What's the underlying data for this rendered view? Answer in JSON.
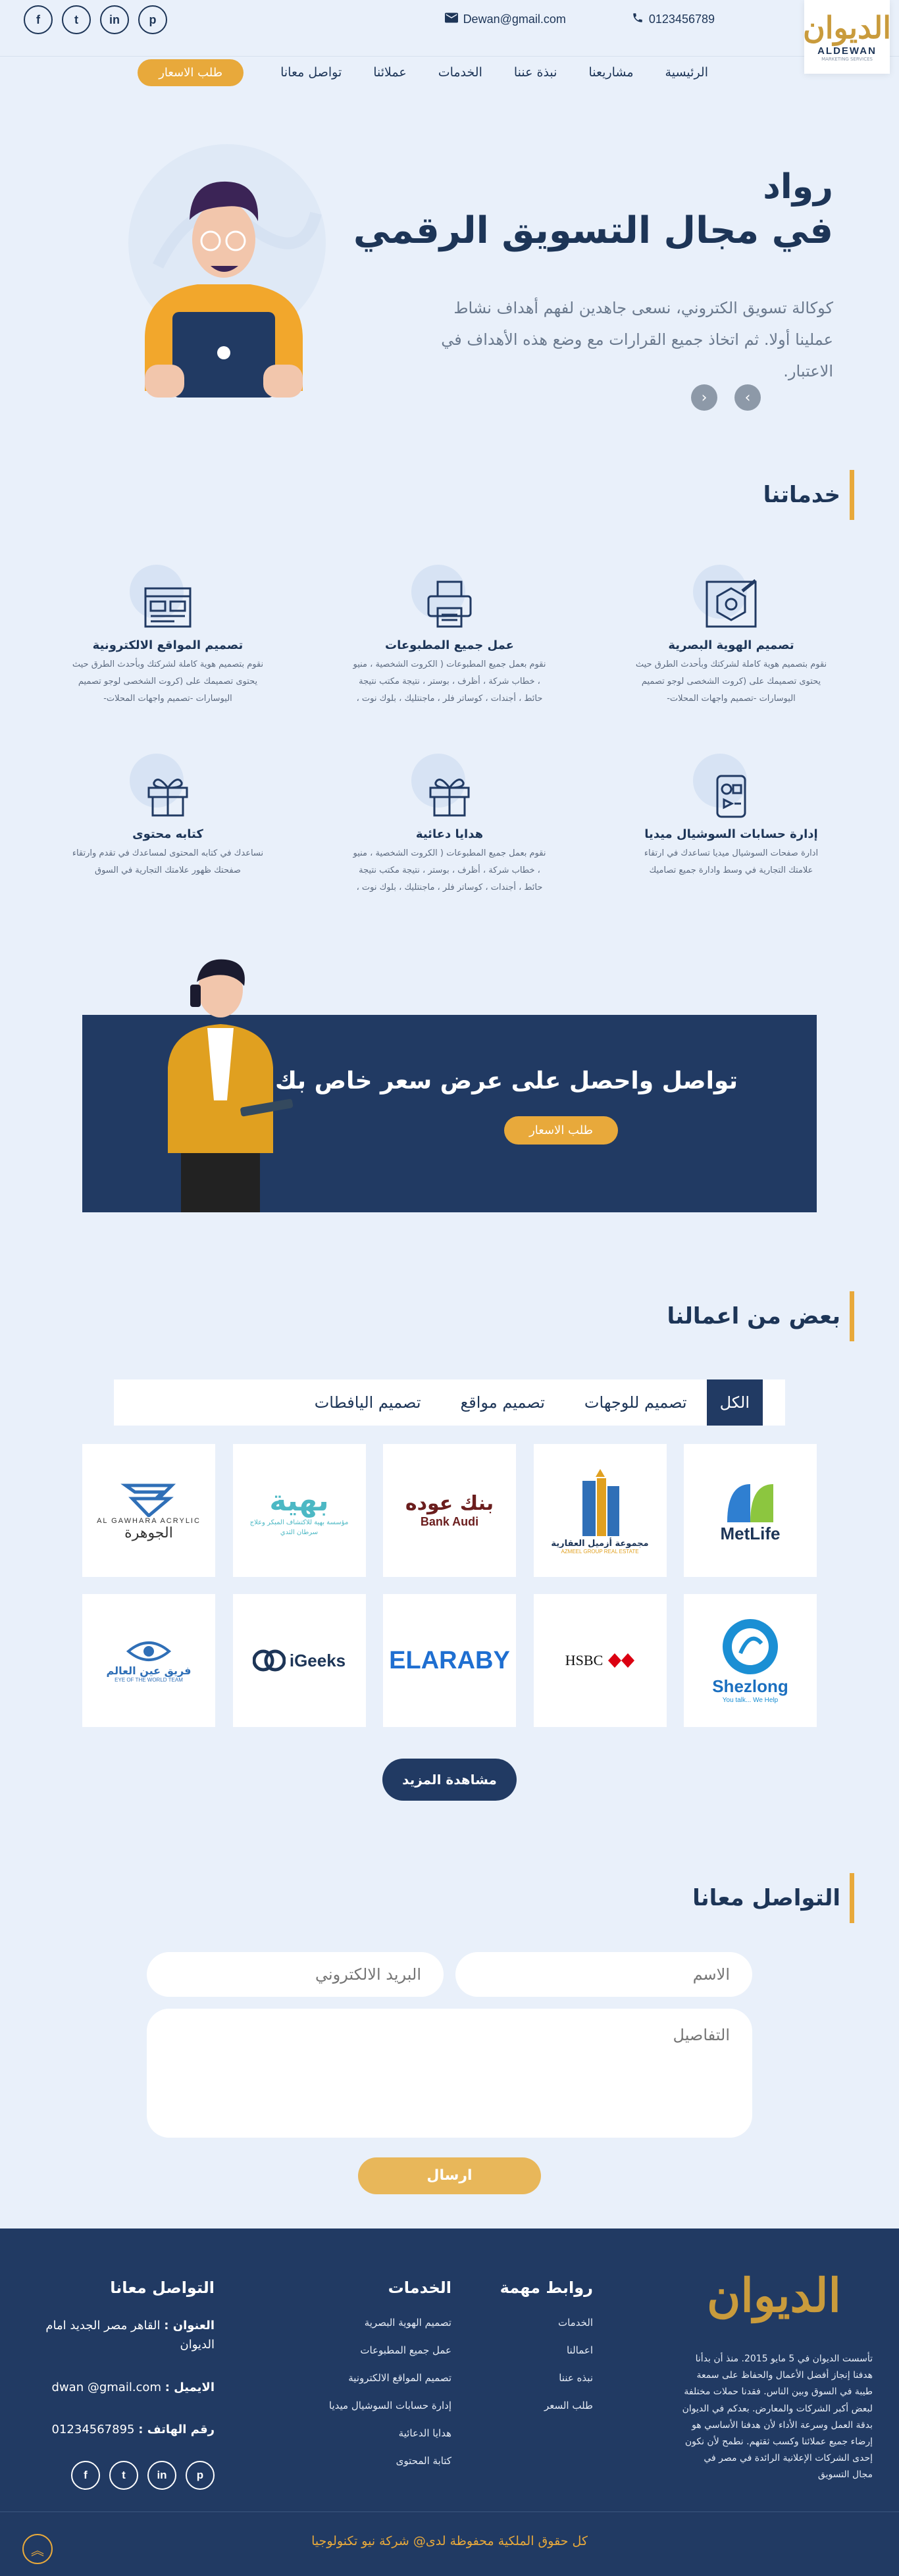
{
  "header": {
    "logo_ar": "الديوان",
    "logo_en": "ALDEWAN",
    "logo_sub": "MARKETING SERVICES",
    "email": "Dewan@gmail.com",
    "phone": "0123456789",
    "socials": [
      "f",
      "t",
      "in",
      "p"
    ],
    "nav": [
      "الرئيسية",
      "مشاريعنا",
      "نبذة عننا",
      "الخدمات",
      "عملائنا",
      "تواصل معانا"
    ],
    "cta": "طلب الاسعار"
  },
  "hero": {
    "title_1": "رواد",
    "title_2": "في مجال التسويق الرقمي",
    "desc": "كوكالة تسويق الكتروني، نسعى جاهدين لفهم أهداف نشاط عملينا أولا. ثم اتخاذ جميع القرارات مع وضع هذه الأهداف في الاعتبار."
  },
  "services": {
    "title": "خدماتنا",
    "items": [
      {
        "icon": "design-icon",
        "title": "تصميم الهوية البصرية",
        "desc": "نقوم بتصميم هوية كاملة لشركتك وبأحدث الطرق حيث يحتوى تصميمك على (كروت الشخصى لوجو تصميم اليوسارات -تصميم واجهات المحلات-"
      },
      {
        "icon": "printer-icon",
        "title": "عمل جميع المطبوعات",
        "desc": "نقوم بعمل جميع المطبوعات ( الكروت الشخصية ، منيو ، خطاب شركة ، أظرف ، بوستر ، نتيجة مكتب نتيجة حائط ، أجندات ، كوساتر فلر ، ماجنتليك ، بلوك نوت ،"
      },
      {
        "icon": "website-icon",
        "title": "تصميم المواقع الالكترونية",
        "desc": "نقوم بتصميم هوية كاملة لشركتك وبأحدث الطرق حيث يحتوى تصميمك على (كروت الشخصى لوجو تصميم اليوسارات -تصميم واجهات المحلات-"
      },
      {
        "icon": "social-icon",
        "title": "إدارة حسابات السوشيال ميديا",
        "desc": "ادارة صفحات السوشيال ميديا تساعدك في ارتقاء علامتك التجارية في وسط وادارة جميع تصاميك"
      },
      {
        "icon": "gift-icon",
        "title": "هدايا دعائية",
        "desc": "نقوم بعمل جميع المطبوعات ( الكروت الشخصية ، منيو ، خطاب شركة ، أظرف ، بوستر ، نتيجة مكتب نتيجة حائط ، أجندات ، كوساتر فلر ، ماجنتليك ، بلوك نوت ،"
      },
      {
        "icon": "gift-icon",
        "title": "كتابه محتوى",
        "desc": "نساعدك في كتابه المحتوى لمساعدك في تقدم وارتقاء صفحتك ظهور علامتك التجارية في السوق"
      }
    ]
  },
  "cta_banner": {
    "title": "تواصل واحصل على عرض سعر خاص بك",
    "button": "طلب الاسعار"
  },
  "works": {
    "title": "بعض من اعمالنا",
    "tabs": [
      "الكل",
      "تصميم للوجهات",
      "تصميم مواقع",
      "تصميم اليافطات"
    ],
    "logos": [
      {
        "name": "MetLife",
        "sub": ""
      },
      {
        "name": "مجموعة أزميل العقارية",
        "sub": "AZMEEL GROUP REAL ESTATE"
      },
      {
        "name": "بنك عوده",
        "sub": "Bank Audi"
      },
      {
        "name": "بهية",
        "sub": "مؤسسة بهية للاكتشاف المبكر وعلاج سرطان الثدي"
      },
      {
        "name": "الجوهرة",
        "sub": "AL GAWHARA ACRYLIC"
      },
      {
        "name": "Shezlong",
        "sub": "You talk... We Help"
      },
      {
        "name": "HSBC",
        "sub": ""
      },
      {
        "name": "ELARABY",
        "sub": ""
      },
      {
        "name": "iGeeks",
        "sub": ""
      },
      {
        "name": "فريق عين العالم",
        "sub": "EYE OF THE WORLD TEAM"
      }
    ],
    "more": "مشاهدة المزيد"
  },
  "contact": {
    "title": "التواصل معانا",
    "name_ph": "الاسم",
    "email_ph": "البريد الالكتروني",
    "details_ph": "التفاصيل",
    "send": "ارسال"
  },
  "footer": {
    "logo": "الديوان",
    "about": "تأسست الديوان في 5 مايو 2015. منذ أن بدأنا هدفنا إنجاز أفضل الأعمال والحفاظ على سمعة طيبة في السوق وبين الناس. فقدنا حملات مختلفة لبعض أكبر الشركات والمعارض. بعدكم في الديوان بدقة العمل وسرعة الأداء لأن هدفنا الأساسي هو إرضاء جميع عملائنا وكسب ثقتهم. نطمح لأن نكون إحدى الشركات الإعلانية الرائدة في مصر في مجال التسويق",
    "links_title": "روابط مهمة",
    "links": [
      "الخدمات",
      "اعمالنا",
      "نبذه عننا",
      "طلب السعر"
    ],
    "services_title": "الخدمات",
    "services": [
      "تصميم الهوية البصرية",
      "عمل جميع المطبوعات",
      "تصميم المواقع الالكترونية",
      "إدارة حسابات السوشيال ميديا",
      "هدايا الدعائية",
      "كتابة المحتوى"
    ],
    "contact_title": "التواصل معانا",
    "address_label": "العنوان :",
    "address": "القاهر مصر الجديد امام الديوان",
    "email_label": "الايميل :",
    "email": "dwan @gmail.com",
    "phone_label": "رقم الهاتف :",
    "phone": "01234567895",
    "copyright": "كل حقوق الملكية محفوظة لدى@ شركة نيو تكنولوجيا"
  }
}
